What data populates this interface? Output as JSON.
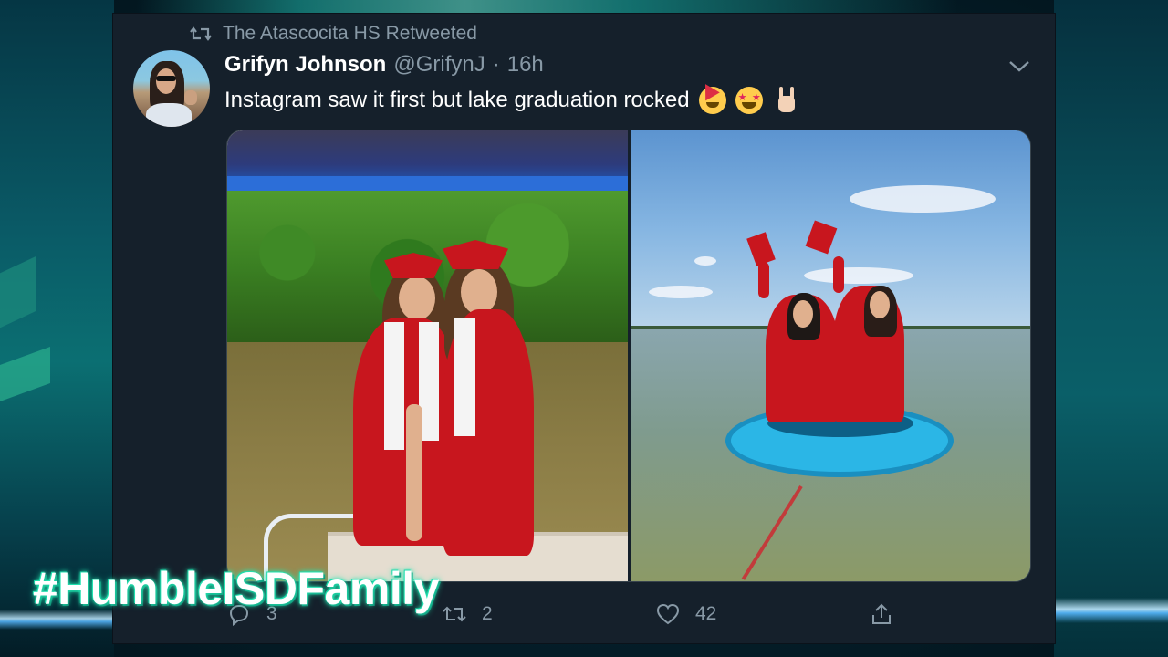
{
  "retweet": {
    "label": "The Atascocita HS Retweeted"
  },
  "author": {
    "display_name": "Grifyn Johnson",
    "handle": "@GrifynJ",
    "separator": "·",
    "time": "16h"
  },
  "tweet": {
    "text": "Instagram saw it first but lake graduation rocked",
    "emojis": [
      "partying-face-emoji",
      "star-struck-emoji",
      "sign-of-the-horns-emoji"
    ]
  },
  "media": {
    "photo_count": 2
  },
  "actions": {
    "replies": "3",
    "retweets": "2",
    "likes": "42"
  },
  "overlay": {
    "hashtag": "#HumbleISDFamily"
  },
  "colors": {
    "card_bg": "#15202b",
    "muted_text": "#8899a6",
    "primary_text": "#ffffff",
    "hashtag_glow": "#23e6b2"
  },
  "icons": [
    "retweet-icon",
    "chevron-down-icon",
    "reply-icon",
    "heart-icon",
    "share-icon"
  ]
}
